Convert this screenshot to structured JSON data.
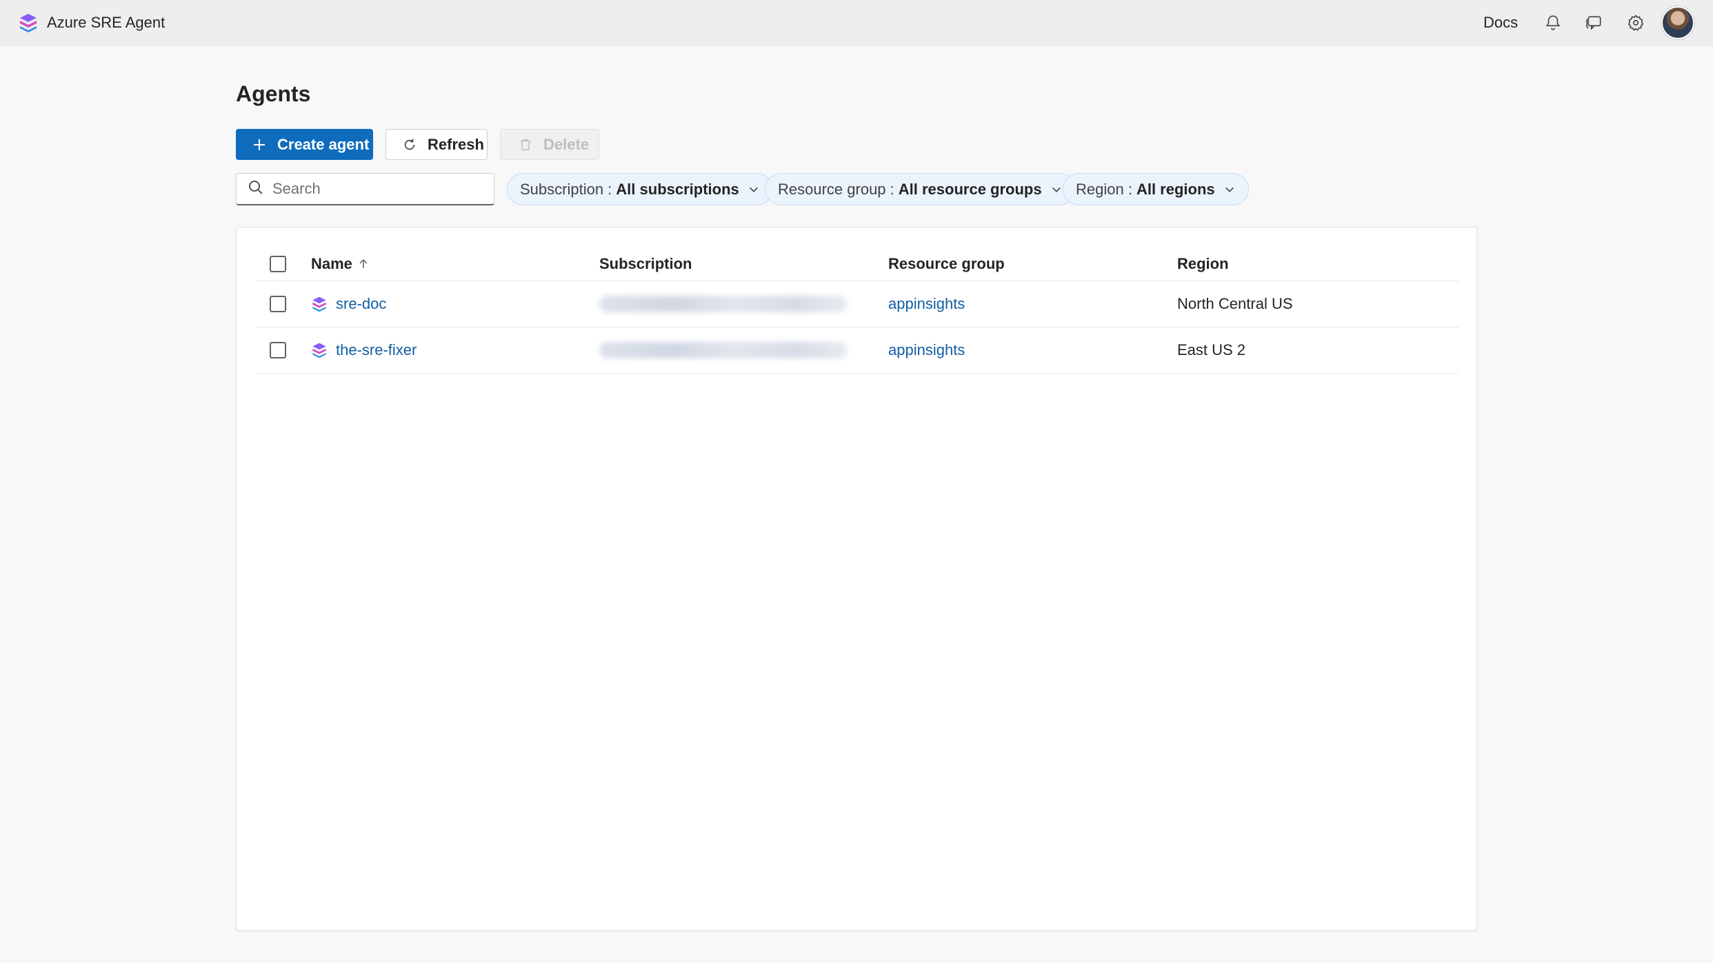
{
  "app": {
    "title": "Azure SRE Agent"
  },
  "topbar": {
    "docs_label": "Docs",
    "icons": [
      "bell-icon",
      "chat-icon",
      "gear-icon"
    ]
  },
  "page": {
    "title": "Agents"
  },
  "toolbar": {
    "create_label": "Create agent",
    "refresh_label": "Refresh",
    "delete_label": "Delete"
  },
  "search": {
    "placeholder": "Search"
  },
  "filters": {
    "subscription": {
      "label": "Subscription :",
      "value": "All subscriptions"
    },
    "resource_group": {
      "label": "Resource group :",
      "value": "All resource groups"
    },
    "region": {
      "label": "Region :",
      "value": "All regions"
    }
  },
  "table": {
    "columns": [
      "Name",
      "Subscription",
      "Resource group",
      "Region"
    ],
    "sort": {
      "column": "Name",
      "direction": "ascending"
    },
    "rows": [
      {
        "name": "sre-doc",
        "subscription": "",
        "resource_group": "appinsights",
        "region": "North Central US"
      },
      {
        "name": "the-sre-fixer",
        "subscription": "",
        "resource_group": "appinsights",
        "region": "East US 2"
      }
    ]
  },
  "colors": {
    "primary": "#0f6cbd",
    "link": "#115ea3",
    "pill_bg": "#ebf3fc",
    "topbar_bg": "#eeeeee"
  }
}
